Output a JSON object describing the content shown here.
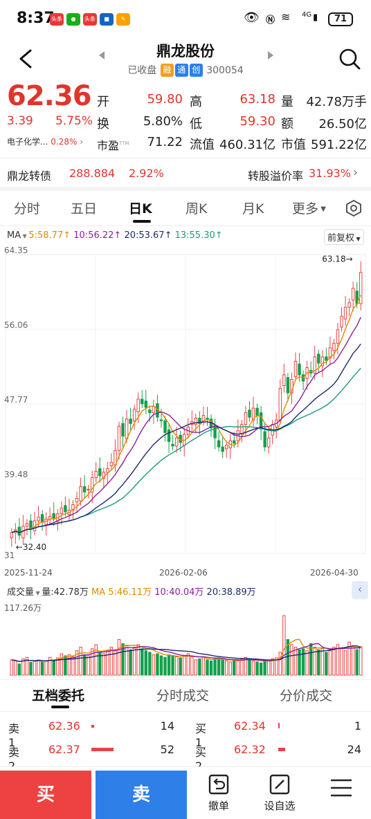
{
  "status": {
    "time": "8:37",
    "app_icon_1": "头条",
    "app_icon_3": "头条",
    "network": "4G",
    "battery": "71"
  },
  "header": {
    "title": "鼎龙股份",
    "status": "已收盘",
    "tags": [
      "融",
      "通",
      "创"
    ],
    "code": "300054"
  },
  "quote": {
    "price": "62.36",
    "change": "3.39",
    "change_pct": "5.75%",
    "sector": "电子化学...",
    "sector_pct": "0.28%",
    "open_label": "开",
    "open": "59.80",
    "high_label": "高",
    "high": "63.18",
    "volume_label": "量",
    "volume": "42.78万手",
    "turnover_label": "换",
    "turnover": "5.80%",
    "low_label": "低",
    "low": "59.30",
    "amount_label": "额",
    "amount": "26.50亿",
    "pe_label": "市盈",
    "pe_sup": "TTM",
    "pe": "71.22",
    "float_mv_label": "流值",
    "float_mv": "460.31亿",
    "mv_label": "市值",
    "mv": "591.22亿"
  },
  "bond": {
    "name": "鼎龙转债",
    "price": "288.884",
    "pct": "2.92%",
    "premium_label": "转股溢价率",
    "premium": "31.93%"
  },
  "tabs": [
    "分时",
    "五日",
    "日K",
    "周K",
    "月K",
    "更多"
  ],
  "active_tab": "日K",
  "ma": {
    "label": "MA",
    "ma5": "5:58.77↑",
    "ma10": "10:56.22↑",
    "ma20": "20:53.67↑",
    "ma30": "13:55.30↑",
    "adjust": "前复权"
  },
  "chart_data": {
    "type": "candlestick",
    "y_labels": [
      "64.35",
      "56.06",
      "47.77",
      "39.48",
      "31"
    ],
    "ylim": [
      31.19,
      64.35
    ],
    "x_labels": [
      "2025-11-24",
      "2026-02-06",
      "2026-04-30"
    ],
    "max_marker": "63.18",
    "min_marker": "32.40",
    "closes": [
      33.5,
      33.8,
      33.2,
      34.2,
      34.5,
      34.0,
      34.8,
      35.2,
      34.7,
      35.0,
      35.3,
      35.0,
      35.6,
      36.2,
      35.8,
      36.0,
      36.6,
      37.3,
      38.6,
      38.0,
      38.3,
      39.6,
      40.3,
      39.8,
      40.2,
      40.6,
      41.3,
      42.6,
      45.3,
      44.2,
      46.1,
      45.6,
      47.2,
      48.3,
      47.8,
      47.4,
      46.8,
      47.5,
      46.3,
      45.9,
      44.6,
      43.6,
      43.1,
      44.0,
      43.5,
      44.4,
      45.2,
      45.8,
      46.2,
      45.6,
      46.5,
      46.1,
      45.1,
      44.0,
      43.0,
      42.5,
      43.2,
      43.7,
      43.4,
      44.8,
      45.5,
      46.8,
      46.3,
      47.3,
      46.5,
      45.0,
      43.0,
      44.0,
      45.5,
      46.0,
      49.5,
      51.0,
      49.0,
      50.5,
      52.5,
      51.0,
      50.3,
      51.8,
      51.2,
      53.0,
      52.3,
      53.0,
      52.6,
      54.0,
      54.5,
      56.0,
      57.5,
      58.5,
      59.0,
      60.6,
      58.9,
      62.36
    ],
    "volume": {
      "label": "成交量",
      "vol": "量:42.78万",
      "ma5": "MA 5:46.11万",
      "ma10": "10:40.04万",
      "ma20": "20:38.89万",
      "ymax_label": "117.26万",
      "values": [
        30,
        28,
        22,
        32,
        35,
        25,
        27,
        30,
        26,
        28,
        35,
        30,
        34,
        42,
        38,
        40,
        36,
        48,
        55,
        40,
        38,
        52,
        60,
        45,
        42,
        48,
        55,
        50,
        70,
        62,
        58,
        50,
        55,
        60,
        52,
        48,
        45,
        40,
        42,
        38,
        35,
        40,
        38,
        36,
        34,
        38,
        42,
        36,
        30,
        32,
        35,
        30,
        28,
        32,
        34,
        30,
        28,
        26,
        30,
        28,
        32,
        35,
        30,
        28,
        26,
        24,
        30,
        28,
        32,
        34,
        45,
        117,
        70,
        60,
        55,
        50,
        52,
        48,
        62,
        55,
        50,
        52,
        45,
        48,
        55,
        60,
        52,
        48,
        65,
        58,
        50,
        56
      ]
    }
  },
  "depth_tabs": [
    "五档委托",
    "分时成交",
    "分价成交"
  ],
  "asks": [
    {
      "label": "卖1",
      "price": "62.36",
      "vol": "14"
    },
    {
      "label": "卖2",
      "price": "62.37",
      "vol": "52"
    }
  ],
  "bids": [
    {
      "label": "买1",
      "price": "62.34",
      "vol": "1"
    },
    {
      "label": "买2",
      "price": "62.32",
      "vol": "24"
    }
  ],
  "bottom": {
    "buy": "买",
    "sell": "卖",
    "cancel": "撤单",
    "watch": "设自选"
  }
}
